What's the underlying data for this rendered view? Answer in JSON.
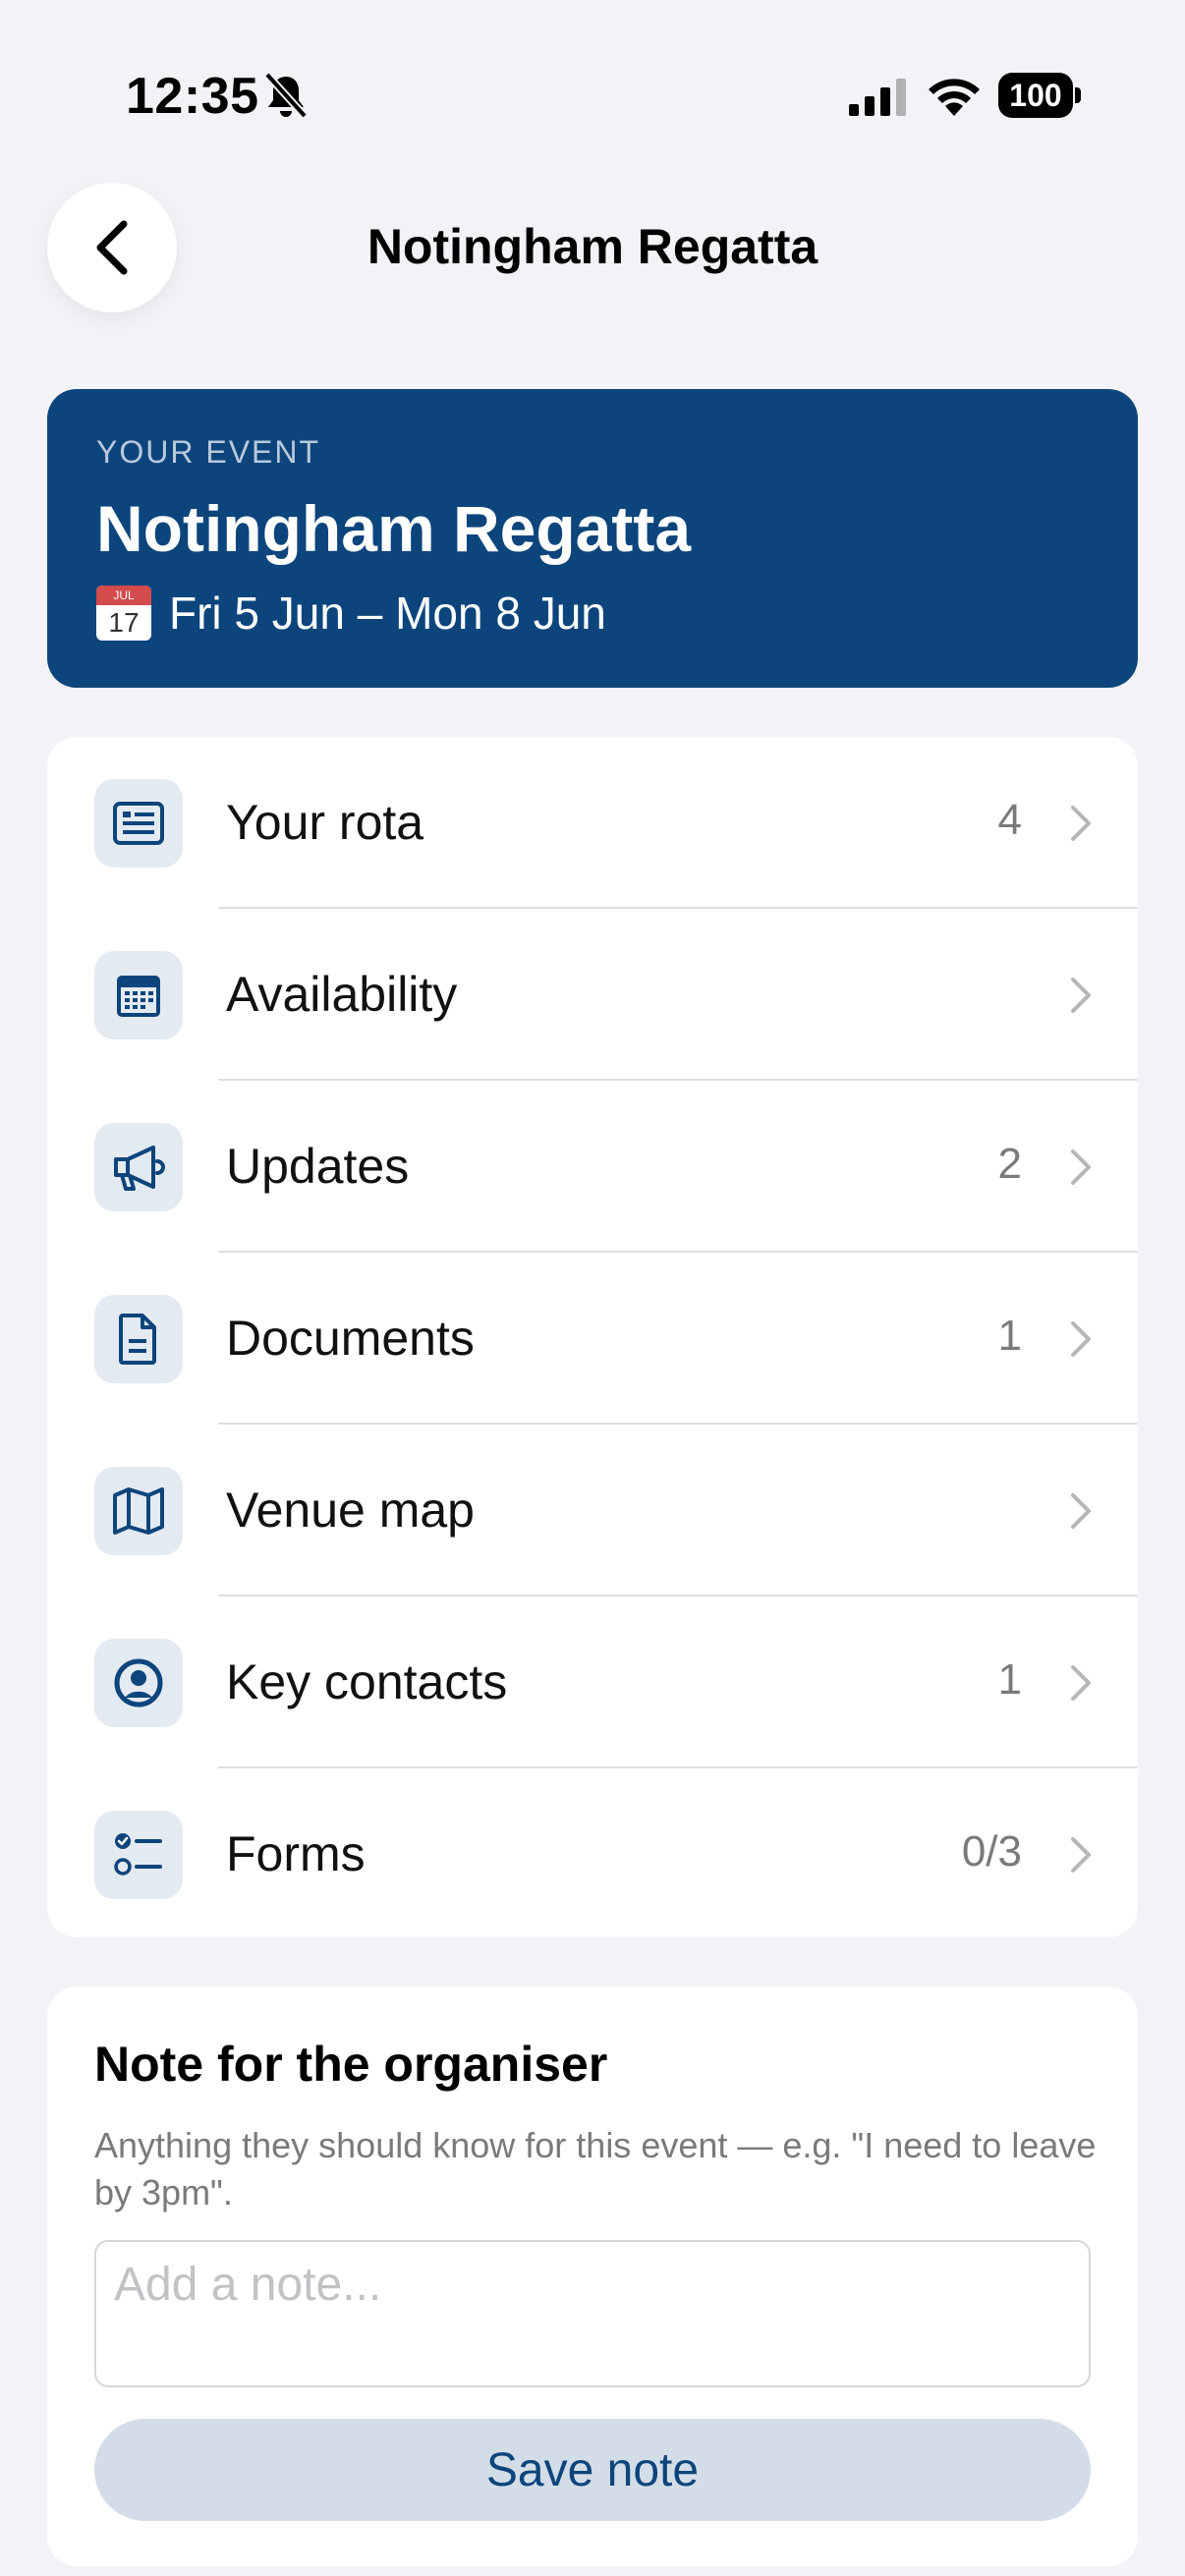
{
  "status_bar": {
    "time": "12:35",
    "battery": "100",
    "icons": [
      "bell-slash-icon",
      "signal-icon",
      "wifi-icon",
      "battery-icon"
    ]
  },
  "header": {
    "title": "Notingham Regatta",
    "back_icon": "chevron-left-icon"
  },
  "event": {
    "kicker": "YOUR EVENT",
    "name": "Notingham Regatta",
    "dates": "Fri 5 Jun – Mon 8 Jun",
    "calendar_emoji": {
      "month": "JUL",
      "day": "17"
    }
  },
  "menu": {
    "items": [
      {
        "label": "Your rota",
        "count": "4",
        "icon": "list-icon"
      },
      {
        "label": "Availability",
        "count": "",
        "icon": "calendar-icon"
      },
      {
        "label": "Updates",
        "count": "2",
        "icon": "megaphone-icon"
      },
      {
        "label": "Documents",
        "count": "1",
        "icon": "document-icon"
      },
      {
        "label": "Venue map",
        "count": "",
        "icon": "map-icon"
      },
      {
        "label": "Key contacts",
        "count": "1",
        "icon": "person-circle-icon"
      },
      {
        "label": "Forms",
        "count": "0/3",
        "icon": "checklist-icon"
      }
    ]
  },
  "note": {
    "title": "Note for the organiser",
    "help": "Anything they should know for this event — e.g. \"I need to leave by 3pm\".",
    "placeholder": "Add a note...",
    "value": "",
    "save_label": "Save note"
  },
  "colors": {
    "accent": "#0c457c",
    "background": "#f2f2f7",
    "icon_bg": "#e4eaf2",
    "button_bg": "#d3dde8"
  }
}
